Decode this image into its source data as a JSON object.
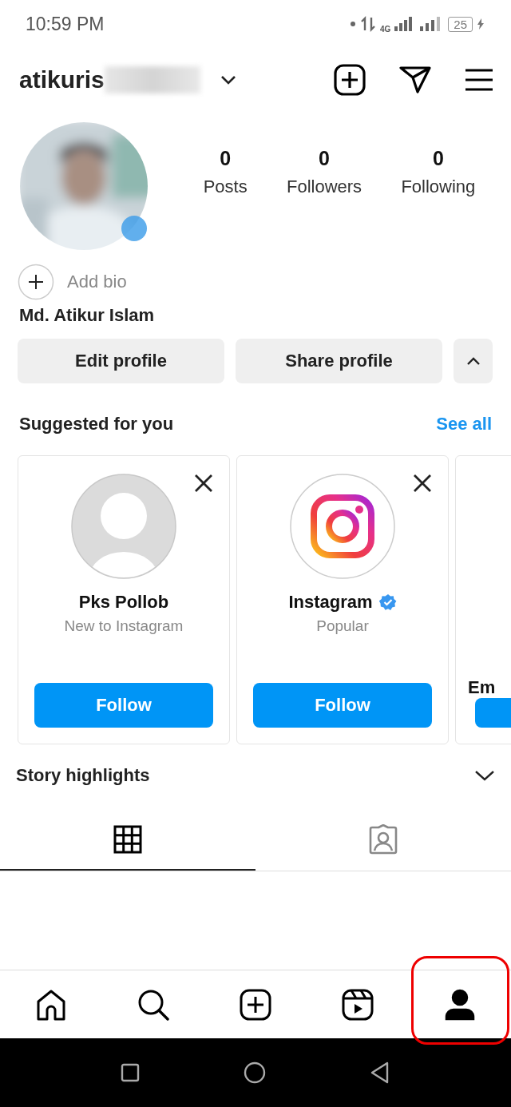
{
  "status_bar": {
    "time": "10:59 PM",
    "network": "4G",
    "battery": "25"
  },
  "header": {
    "username": "atikuris",
    "username_blurred": true
  },
  "profile": {
    "stats": [
      {
        "value": "0",
        "label": "Posts"
      },
      {
        "value": "0",
        "label": "Followers"
      },
      {
        "value": "0",
        "label": "Following"
      }
    ],
    "add_bio": "Add bio",
    "full_name": "Md. Atikur Islam"
  },
  "actions": [
    {
      "label": "Edit profile"
    },
    {
      "label": "Share profile"
    }
  ],
  "suggested": {
    "title": "Suggested for you",
    "see_all": "See all",
    "cards": [
      {
        "kind": "default",
        "name": "Pks Pollob",
        "verified": false,
        "subtitle": "New to Instagram",
        "follow": "Follow"
      },
      {
        "kind": "instagram",
        "name": "Instagram",
        "verified": true,
        "subtitle": "Popular",
        "follow": "Follow"
      },
      {
        "kind": "partial",
        "name": "Em",
        "verified": false
      }
    ]
  },
  "story_highlights": {
    "title": "Story highlights",
    "expanded": false
  },
  "content_tabs": [
    {
      "kind": "grid",
      "selected": true
    },
    {
      "kind": "tagged",
      "selected": false
    }
  ],
  "nav": [
    {
      "kind": "home",
      "selected": false,
      "highlighted": false
    },
    {
      "kind": "search",
      "selected": false,
      "highlighted": false
    },
    {
      "kind": "create",
      "selected": false,
      "highlighted": false
    },
    {
      "kind": "reels",
      "selected": false,
      "highlighted": false
    },
    {
      "kind": "profile",
      "selected": true,
      "highlighted": true
    }
  ]
}
